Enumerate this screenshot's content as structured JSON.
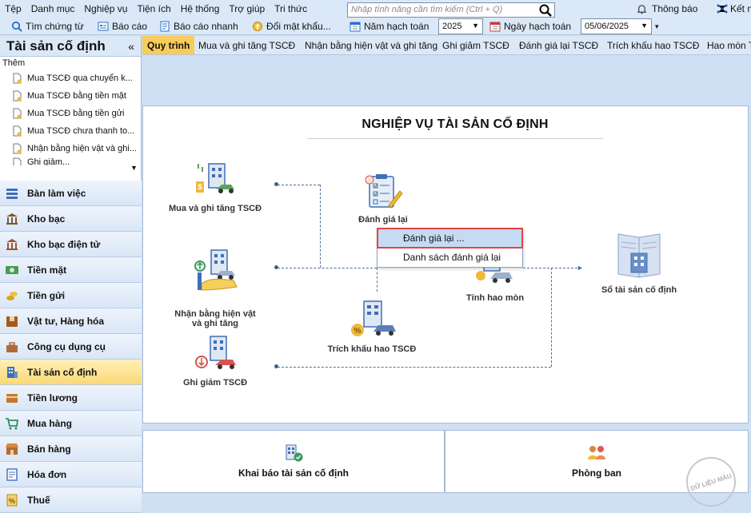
{
  "menubar": {
    "items": [
      "Tệp",
      "Danh mục",
      "Nghiệp vụ",
      "Tiện ích",
      "Hệ thống",
      "Trợ giúp",
      "Tri thức"
    ],
    "search_placeholder": "Nhập tính năng cần tìm kiếm (Ctrl + Q)",
    "notify_label": "Thông báo",
    "connect_label": "Kết nố"
  },
  "toolbar": {
    "find_voucher": "Tìm chứng từ",
    "report": "Báo cáo",
    "quick_report": "Báo cáo nhanh",
    "change_password": "Đổi mật khẩu...",
    "fiscal_year_label": "Năm hạch toán",
    "fiscal_year_value": "2025",
    "posting_date_label": "Ngày hạch toán",
    "posting_date_value": "05/06/2025"
  },
  "sidebar": {
    "title": "Tài sản cố định",
    "collapse": "«",
    "add_label": "Thêm",
    "tasks": [
      "Mua TSCĐ qua chuyển k...",
      "Mua TSCĐ bằng tiền mặt",
      "Mua TSCĐ bằng tiền gửi",
      "Mua TSCĐ chưa thanh to...",
      "Nhận bằng hiện vật và ghi...",
      "Ghi giảm..."
    ],
    "modules": [
      "Bàn làm việc",
      "Kho bạc",
      "Kho bạc điện tử",
      "Tiền mặt",
      "Tiền gửi",
      "Vật tư, Hàng hóa",
      "Công cụ dụng cụ",
      "Tài sản cố định",
      "Tiền lương",
      "Mua hàng",
      "Bán hàng",
      "Hóa đơn",
      "Thuế"
    ],
    "active_module": "Tài sản cố định"
  },
  "tabs": [
    "Quy trình",
    "Mua và ghi tăng TSCĐ",
    "Nhận bằng hiện vật và ghi tăng",
    "Ghi giảm TSCĐ",
    "Đánh giá lại TSCĐ",
    "Trích khấu hao TSCĐ",
    "Hao mòn T"
  ],
  "process": {
    "title": "NGHIỆP VỤ TÀI SẢN CỐ ĐỊNH",
    "buy": "Mua và ghi tăng TSCĐ",
    "receive": "Nhận bằng hiện vật\nvà ghi tăng",
    "decrease": "Ghi giảm TSCĐ",
    "revalue": "Đánh giá lại",
    "wear": "Tính hao mòn",
    "depreciation": "Trích khấu hao TSCĐ",
    "ledger": "Sổ tài sản cố định"
  },
  "popup": {
    "items": [
      "Đánh giá lại ...",
      "Danh sách đánh giá lại"
    ]
  },
  "bottom": {
    "declare": "Khai báo tài sản cố định",
    "department": "Phòng ban"
  },
  "watermark": "DỮ LIỆU MẪU"
}
